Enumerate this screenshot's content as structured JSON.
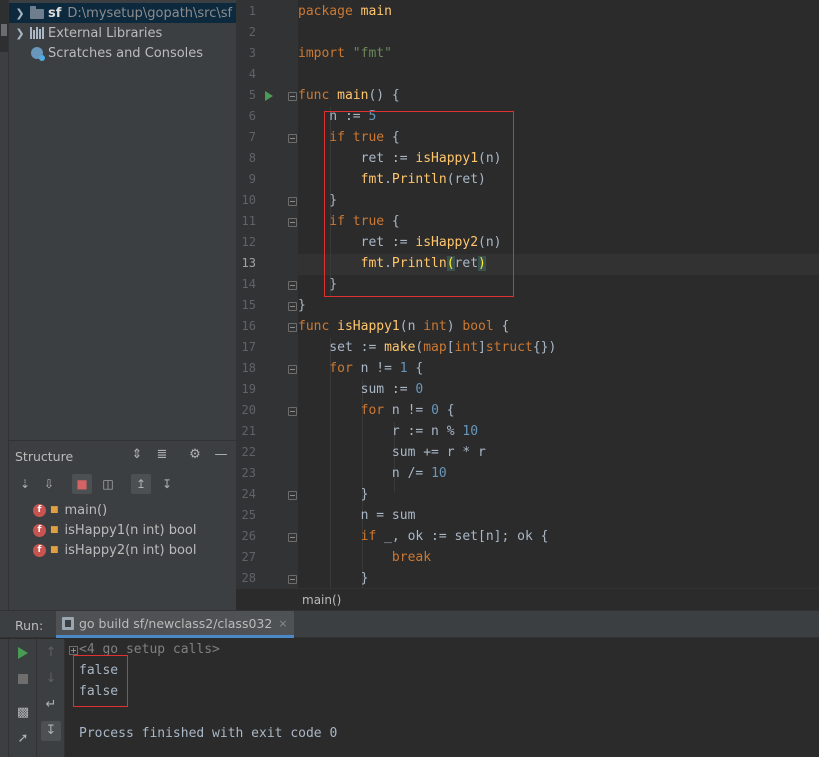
{
  "project_tree": {
    "items": [
      {
        "name": "sf",
        "path": "D:\\mysetup\\gopath\\src\\sf"
      },
      {
        "name": "External Libraries"
      },
      {
        "name": "Scratches and Consoles"
      }
    ]
  },
  "structure": {
    "title": "Structure",
    "items": [
      {
        "badge": "f",
        "label": "main()"
      },
      {
        "badge": "f",
        "label": "isHappy1(n int) bool"
      },
      {
        "badge": "f",
        "label": "isHappy2(n int) bool"
      }
    ]
  },
  "editor": {
    "line_numbers": [
      "1",
      "2",
      "3",
      "4",
      "5",
      "6",
      "7",
      "8",
      "9",
      "10",
      "11",
      "12",
      "13",
      "14",
      "15",
      "16",
      "17",
      "18",
      "19",
      "20",
      "21",
      "22",
      "23",
      "24",
      "25",
      "26",
      "27",
      "28"
    ],
    "current_line": "13",
    "breadcrumb": "main()"
  },
  "run": {
    "label": "Run:",
    "tab_title": "go build sf/newclass2/class032",
    "tab_close": "×",
    "console": {
      "setup_calls": "<4 go setup calls>",
      "output": [
        "false",
        "false"
      ],
      "exit_message": "Process finished with exit code 0"
    }
  },
  "colors": {
    "keyword": "#cc7832",
    "function": "#ffc66d",
    "string": "#6a8759",
    "number": "#6897bb",
    "plain": "#a9b7c6",
    "highlight_box": "#e03030",
    "run_green": "#499c54"
  }
}
